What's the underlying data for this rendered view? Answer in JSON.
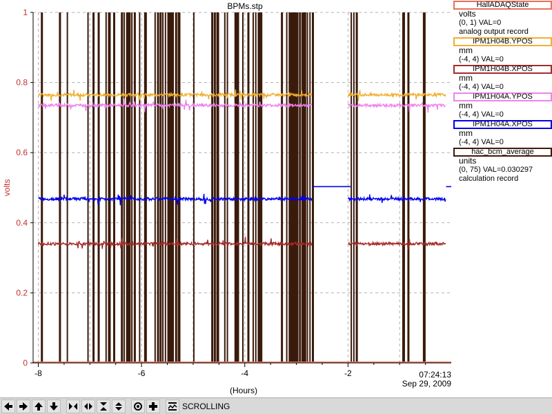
{
  "chart_data": {
    "type": "line",
    "title": "BPMs.stp",
    "xlabel": "(Hours)",
    "ylabel": "volts",
    "xlim": [
      -8.1,
      0.0
    ],
    "ylim": [
      0,
      1
    ],
    "x_ticks": [
      -8,
      -6,
      -4,
      -2
    ],
    "x_tick_labels": [
      "-8",
      "-6",
      "-4",
      "-2"
    ],
    "y_ticks": [
      0,
      0.2,
      0.4,
      0.6,
      0.8,
      1
    ],
    "y_tick_labels": [
      "0",
      "0.2",
      "0.4",
      "0.6",
      "0.8",
      "1"
    ],
    "grid": true,
    "end_time": "07:24:13",
    "end_date": "Sep 29, 2009",
    "series": [
      {
        "name": "HallADAQState",
        "color": "#e8705a",
        "baseline": 0.0
      },
      {
        "name": "IPM1H04B.YPOS",
        "color": "#f0b030",
        "baseline": 0.765,
        "segments": [
          [
            -8.0,
            -2.7
          ],
          [
            -2.0,
            -0.1
          ]
        ]
      },
      {
        "name": "IPM1H04A.YPOS",
        "color": "#ee82ee",
        "baseline": 0.735,
        "segments": [
          [
            -8.0,
            -2.7
          ],
          [
            -2.0,
            -0.1
          ]
        ]
      },
      {
        "name": "IPM1H04A.XPOS",
        "color": "#0000ee",
        "baseline": 0.468,
        "segments": [
          [
            -8.0,
            -2.7
          ],
          [
            -2.0,
            -0.1
          ]
        ],
        "flat": [
          {
            "x": [
              -2.7,
              -1.95
            ],
            "y": 0.503
          },
          {
            "x": [
              -0.1,
              0.0
            ],
            "y": 0.503
          }
        ]
      },
      {
        "name": "IPM1H04B.XPOS",
        "color": "#a52a2a",
        "baseline": 0.34,
        "segments": [
          [
            -8.0,
            -2.7
          ],
          [
            -2.0,
            -0.1
          ]
        ]
      },
      {
        "name": "hac_bcm_average",
        "color": "#3a1a0a",
        "pulses": [
          -7.95,
          -7.6,
          -7.45,
          -7.05,
          -6.95,
          -6.85,
          -6.7,
          -6.65,
          -6.55,
          -6.4,
          -6.35,
          -6.3,
          -6.25,
          -6.2,
          -6.15,
          -6.05,
          -5.95,
          -5.75,
          -5.7,
          -5.65,
          -5.6,
          -5.55,
          -5.5,
          -5.45,
          -5.4,
          -5.35,
          -5.3,
          -5.0,
          -4.65,
          -4.6,
          -4.55,
          -4.4,
          -4.35,
          -4.2,
          -4.15,
          -4.05,
          -3.95,
          -3.85,
          -3.8,
          -3.75,
          -3.7,
          -3.3,
          -3.2,
          -3.15,
          -3.12,
          -3.1,
          -3.05,
          -3.02,
          -3.0,
          -2.95,
          -2.9,
          -2.85,
          -2.8,
          -2.75,
          -2.7,
          -1.95,
          -1.9,
          -1.85,
          -0.95,
          -0.85,
          -0.55
        ]
      }
    ]
  },
  "legend": [
    {
      "name": "HallADAQState",
      "color": "#e8705a",
      "units": "volts",
      "range": "(0, 1) VAL=0",
      "desc": "analog output record"
    },
    {
      "name": "IPM1H04B.YPOS",
      "color": "#f0b030",
      "units": "mm",
      "range": "(-4, 4) VAL=0",
      "desc": ""
    },
    {
      "name": "IPM1H04B.XPOS",
      "color": "#a52a2a",
      "units": "mm",
      "range": "(-4, 4) VAL=0",
      "desc": ""
    },
    {
      "name": "IPM1H04A.YPOS",
      "color": "#ee82ee",
      "units": "mm",
      "range": "(-4, 4) VAL=0",
      "desc": ""
    },
    {
      "name": "IPM1H04A.XPOS",
      "color": "#0000ee",
      "units": "mm",
      "range": "(-4, 4) VAL=0",
      "desc": ""
    },
    {
      "name": "hac_bcm_average",
      "color": "#3a1a0a",
      "units": "units",
      "range": "(0, 75) VAL=0.030297",
      "desc": "calculation record"
    }
  ],
  "toolbar": {
    "buttons": [
      "pan-left-icon",
      "pan-right-icon",
      "pan-up-icon",
      "pan-down-icon",
      "zoom-in-x-icon",
      "zoom-out-x-icon",
      "zoom-in-y-icon",
      "zoom-out-y-icon",
      "reset-icon",
      "add-icon",
      "scroll-icon"
    ],
    "status": "SCROLLING"
  }
}
